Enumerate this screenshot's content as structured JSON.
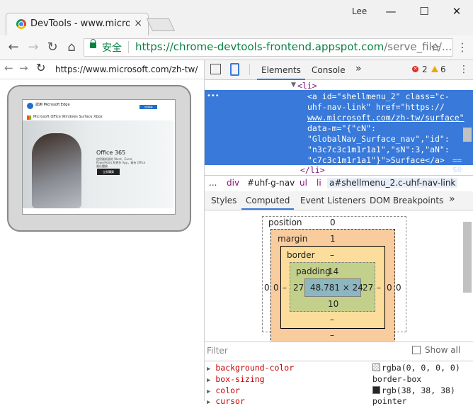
{
  "browser": {
    "tab_title": "DevTools - www.microso",
    "tab_close": "×",
    "user": "Lee",
    "win_min": "—",
    "win_max": "☐",
    "win_close": "✕",
    "secure_label": "安全",
    "url_main": "https://chrome-devtools-frontend.appspot.com",
    "url_rest": "/serve_file/...",
    "back": "←",
    "forward": "→",
    "reload": "↻",
    "home": "⌂",
    "star": "☆",
    "menu": "⋮"
  },
  "viewport": {
    "url": "https://www.microsoft.com/zh-tw/",
    "back": "←",
    "forward": "→",
    "reload": "↻",
    "page": {
      "edge_title": "試用 Microsoft Edge",
      "edge_button": "立即取得",
      "nav": "Microsoft   Office   Windows   Surface   Xbox",
      "office_title": "Office 365",
      "office_desc": "使用最新版的 Word、Excel、PowerPoint 和更多 App，擁有 Office 最佳體驗",
      "office_button": "立即購買"
    }
  },
  "devtools": {
    "inspect_icon": "⬚",
    "device_icon": "▯",
    "tabs": [
      "Elements",
      "Console",
      "»"
    ],
    "errors": "2",
    "warnings": "6",
    "kebab": "⋮",
    "dom": {
      "li_open": "<li>",
      "dots": "•••",
      "selected_lines": [
        "<a id=\"shellmenu_2\" class=\"c-",
        "uhf-nav-link\" href=\"https://",
        "www.microsoft.com/zh-tw/surface\"",
        "data-m=\"{\"cN\":",
        "\"GlobalNav_Surface_nav\",\"id\":",
        "\"n3c7c3c1m1r1a1\",\"sN\":3,\"aN\":",
        "\"c7c3c1m1r1a1\"}\">Surface</a>"
      ],
      "eq": "== $0",
      "li_close": "</li>"
    },
    "breadcrumbs": [
      "...",
      "div",
      "#uhf-g-nav",
      "ul",
      "li",
      "a#shellmenu_2.c-uhf-nav-link"
    ],
    "subtabs": [
      "Styles",
      "Computed",
      "Event Listeners",
      "DOM Breakpoints",
      "»"
    ],
    "box_model": {
      "position_label": "position",
      "position_value": "0",
      "margin_label": "margin",
      "margin_top": "1",
      "margin_left": "0",
      "margin_right": "0",
      "margin_bottom": "–",
      "border_label": "border",
      "border_top": "–",
      "border_left": "–",
      "border_right": "–",
      "border_bottom": "–",
      "padding_label": "padding",
      "padding_top": "14",
      "padding_left": "27",
      "padding_right": "27",
      "padding_bottom": "10",
      "content": "48.781 × 24",
      "pos_left": "0",
      "pos_right": "0",
      "pos_bottom": "–"
    },
    "filter_placeholder": "Filter",
    "show_all": "Show all",
    "properties": [
      {
        "name": "background-color",
        "value": "rgba(0, 0, 0, 0)",
        "swatch": "transparent"
      },
      {
        "name": "box-sizing",
        "value": "border-box",
        "swatch": ""
      },
      {
        "name": "color",
        "value": "rgb(38, 38, 38)",
        "swatch": "#262626"
      },
      {
        "name": "cursor",
        "value": "pointer",
        "swatch": ""
      }
    ]
  },
  "colors": {
    "accent": "#3879d9",
    "secure_green": "#0b8043",
    "error_red": "#d93025",
    "warning_yellow": "#f2a600"
  }
}
